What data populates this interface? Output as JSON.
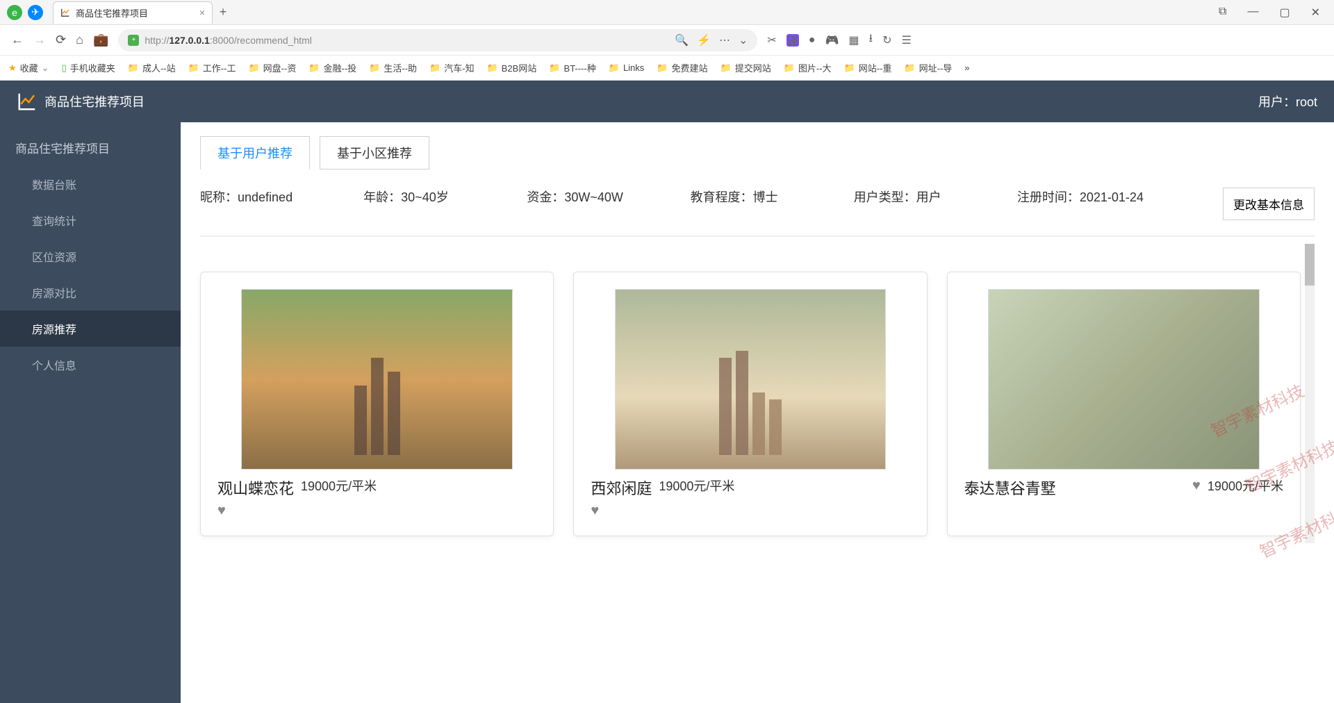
{
  "browser": {
    "tab_title": "商品住宅推荐项目",
    "url_prefix": "http://",
    "url_host": "127.0.0.1",
    "url_port": ":8000",
    "url_path": "/recommend_html",
    "bookmarks_label": "收藏",
    "mobile_bookmarks": "手机收藏夹",
    "bookmarks": [
      "成人--站",
      "工作--工",
      "网盘--资",
      "金融--投",
      "生活--助",
      "汽车-知",
      "B2B网站",
      "BT----种",
      "Links",
      "免费建站",
      "提交网站",
      "图片--大",
      "网站--重",
      "网址--导"
    ],
    "overflow": "»"
  },
  "header": {
    "app_title": "商品住宅推荐项目",
    "user_label": "用户：root"
  },
  "sidebar": {
    "title": "商品住宅推荐项目",
    "items": [
      {
        "label": "数据台账"
      },
      {
        "label": "查询统计"
      },
      {
        "label": "区位资源"
      },
      {
        "label": "房源对比"
      },
      {
        "label": "房源推荐"
      },
      {
        "label": "个人信息"
      }
    ]
  },
  "tabs": {
    "tab1": "基于用户推荐",
    "tab2": "基于小区推荐"
  },
  "userinfo": {
    "nickname": "昵称：undefined",
    "age": "年龄：30~40岁",
    "funds": "资金：30W~40W",
    "education": "教育程度：博士",
    "usertype": "用户类型：用户",
    "regtime": "注册时间：2021-01-24",
    "edit_btn": "更改基本信息"
  },
  "cards": [
    {
      "title": "观山蝶恋花",
      "price": "19000元/平米"
    },
    {
      "title": "西郊闲庭",
      "price": "19000元/平米"
    },
    {
      "title": "泰达慧谷青墅",
      "price": "19000元/平米"
    }
  ],
  "watermark": "智宇素材科技"
}
